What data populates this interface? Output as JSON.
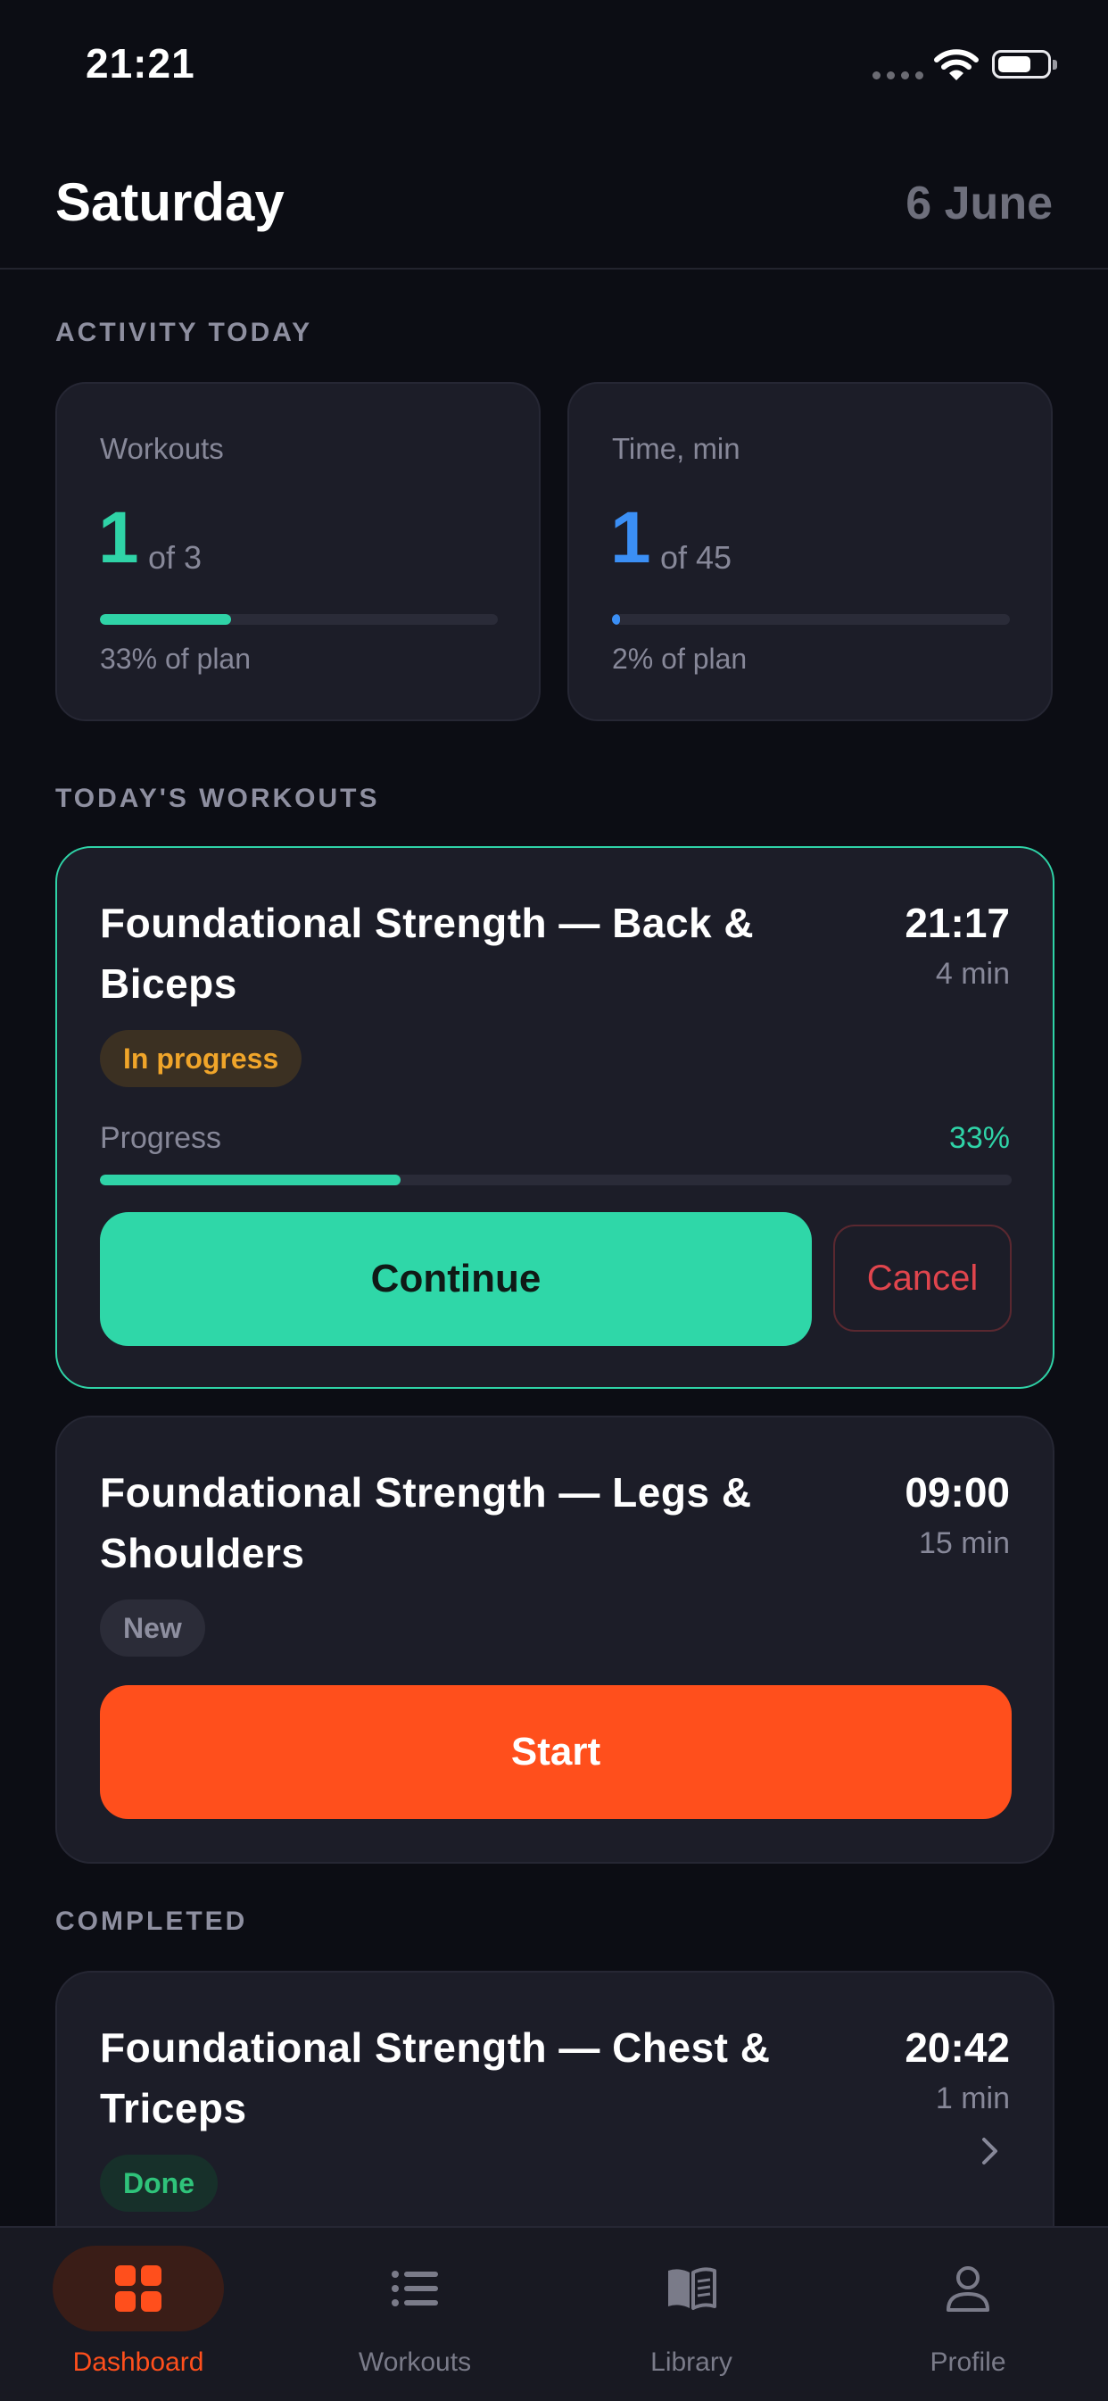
{
  "status_bar": {
    "time": "21:21"
  },
  "header": {
    "day": "Saturday",
    "date": "6 June"
  },
  "activity": {
    "section_label": "ACTIVITY TODAY",
    "workouts": {
      "label": "Workouts",
      "value": "1",
      "of": "of 3",
      "note": "33% of plan",
      "progress_fraction": 0.33,
      "color": "#2fd3a7"
    },
    "time": {
      "label": "Time, min",
      "value": "1",
      "of": "of 45",
      "note": "2% of plan",
      "progress_fraction": 0.02,
      "color": "#3b8ff5"
    }
  },
  "todays_workouts": {
    "section_label": "TODAY'S WORKOUTS",
    "items": [
      {
        "title": "Foundational Strength — Back & Biceps",
        "time": "21:17",
        "duration": "4 min",
        "badge": "In progress",
        "progress_label": "Progress",
        "progress_pct": "33%",
        "progress_fraction": 0.33,
        "primary_action": "Continue",
        "secondary_action": "Cancel"
      },
      {
        "title": "Foundational Strength — Legs & Shoulders",
        "time": "09:00",
        "duration": "15 min",
        "badge": "New",
        "primary_action": "Start"
      }
    ]
  },
  "completed": {
    "section_label": "COMPLETED",
    "items": [
      {
        "title": "Foundational Strength — Chest & Triceps",
        "time": "20:42",
        "duration": "1 min",
        "badge": "Done",
        "icon": "chevron-right-icon"
      }
    ]
  },
  "tab_bar": {
    "items": [
      {
        "label": "Dashboard",
        "icon": "grid-icon",
        "active": true
      },
      {
        "label": "Workouts",
        "icon": "list-icon",
        "active": false
      },
      {
        "label": "Library",
        "icon": "book-icon",
        "active": false
      },
      {
        "label": "Profile",
        "icon": "person-icon",
        "active": false
      }
    ]
  },
  "colors": {
    "accent_green": "#2fd3a7",
    "accent_blue": "#3b8ff5",
    "accent_orange": "#ff4f1c",
    "danger": "#e0454d",
    "badge_in_progress": "#f0a52a",
    "badge_done": "#2fc37a"
  }
}
